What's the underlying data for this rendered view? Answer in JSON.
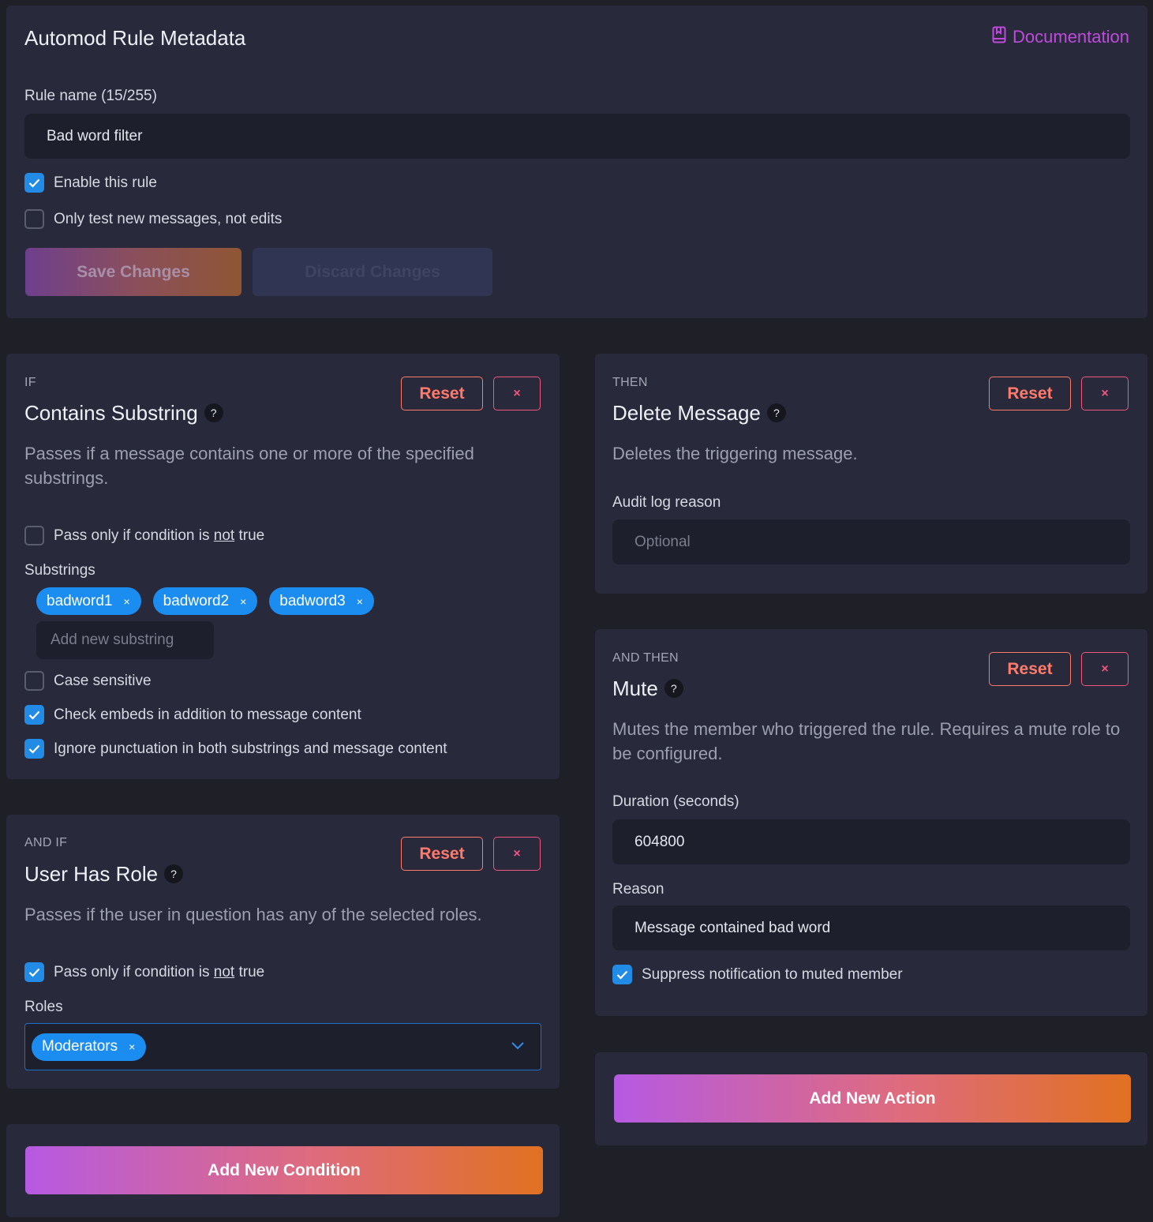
{
  "metadata": {
    "title": "Automod Rule Metadata",
    "doc_link": "Documentation",
    "rule_name_label": "Rule name (15/255)",
    "rule_name_value": "Bad word filter",
    "enable_label": "Enable this rule",
    "enable_checked": true,
    "only_new_label": "Only test new messages, not edits",
    "only_new_checked": false,
    "save_label": "Save Changes",
    "discard_label": "Discard Changes"
  },
  "condition1": {
    "kicker": "IF",
    "title": "Contains Substring",
    "help": "?",
    "description": "Passes if a message contains one or more of the specified substrings.",
    "reset_label": "Reset",
    "remove_label": "×",
    "invert_prefix": "Pass only if condition is ",
    "invert_not": "not",
    "invert_suffix": " true",
    "invert_checked": false,
    "substrings_label": "Substrings",
    "substrings": [
      "badword1",
      "badword2",
      "badword3"
    ],
    "tag_remove": "×",
    "add_placeholder": "Add new substring",
    "case_label": "Case sensitive",
    "case_checked": false,
    "embeds_label": "Check embeds in addition to message content",
    "embeds_checked": true,
    "punct_label": "Ignore punctuation in both substrings and message content",
    "punct_checked": true
  },
  "condition2": {
    "kicker": "AND IF",
    "title": "User Has Role",
    "help": "?",
    "description": "Passes if the user in question has any of the selected roles.",
    "reset_label": "Reset",
    "remove_label": "×",
    "invert_prefix": "Pass only if condition is ",
    "invert_not": "not",
    "invert_suffix": " true",
    "invert_checked": true,
    "roles_label": "Roles",
    "roles": [
      "Moderators"
    ],
    "tag_remove": "×"
  },
  "add_condition_label": "Add New Condition",
  "action1": {
    "kicker": "THEN",
    "title": "Delete Message",
    "help": "?",
    "description": "Deletes the triggering message.",
    "reset_label": "Reset",
    "remove_label": "×",
    "audit_label": "Audit log reason",
    "audit_placeholder": "Optional"
  },
  "action2": {
    "kicker": "AND THEN",
    "title": "Mute",
    "help": "?",
    "description": "Mutes the member who triggered the rule. Requires a mute role to be configured.",
    "reset_label": "Reset",
    "remove_label": "×",
    "duration_label": "Duration (seconds)",
    "duration_value": "604800",
    "reason_label": "Reason",
    "reason_value": "Message contained bad word",
    "suppress_label": "Suppress notification to muted member",
    "suppress_checked": true
  },
  "add_action_label": "Add New Action",
  "colors": {
    "accent": "#228be6",
    "reset": "#ff7a6b",
    "remove": "#f0567e",
    "doc_link": "#be4bdb",
    "card_bg": "#282a3c",
    "page_bg": "#1e1f27"
  }
}
